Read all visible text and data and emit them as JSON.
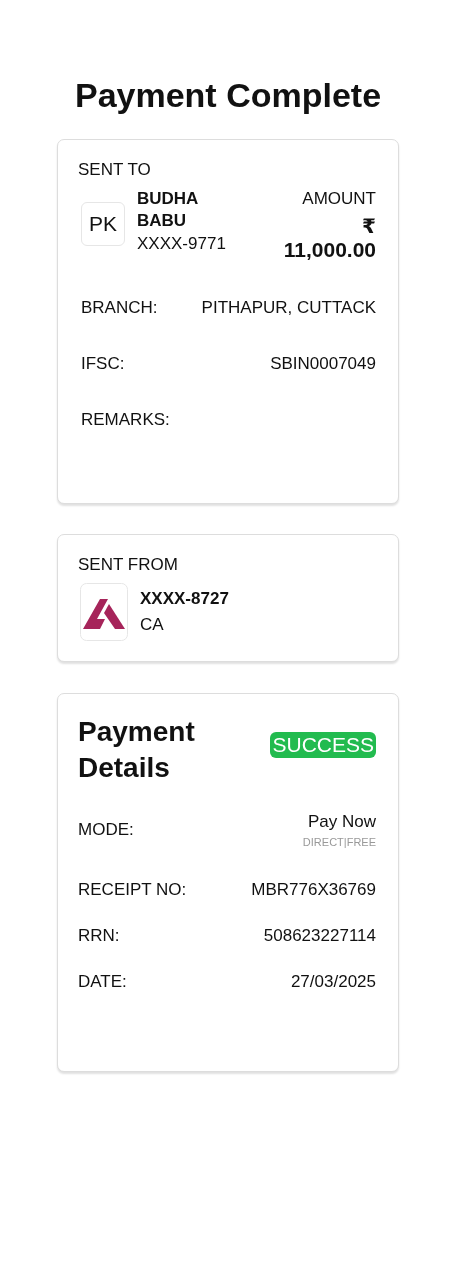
{
  "title": "Payment Complete",
  "sent_to": {
    "heading": "SENT TO",
    "initials": "PK",
    "name": "BUDHA BABU",
    "account": "XXXX-9771",
    "amount_label": "AMOUNT",
    "currency": "₹",
    "amount": "11,000.00",
    "rows": [
      {
        "label": "BRANCH:",
        "value": "PITHAPUR, CUTTACK"
      },
      {
        "label": "IFSC:",
        "value": "SBIN0007049"
      },
      {
        "label": "REMARKS:"
      }
    ]
  },
  "sent_from": {
    "heading": "SENT FROM",
    "account": "XXXX-8727",
    "type": "CA"
  },
  "details": {
    "heading": "Payment Details",
    "status": {
      "label": "SUCCESS",
      "kind": "success"
    },
    "rows": [
      {
        "label": "MODE:",
        "value": "Pay Now",
        "note": "DIRECT|FREE"
      },
      {
        "label": "RECEIPT NO:",
        "value": "MBR776X36769"
      },
      {
        "label": "RRN:",
        "value": "508623227114"
      },
      {
        "label": "DATE:",
        "value": "27/03/2025"
      }
    ]
  }
}
